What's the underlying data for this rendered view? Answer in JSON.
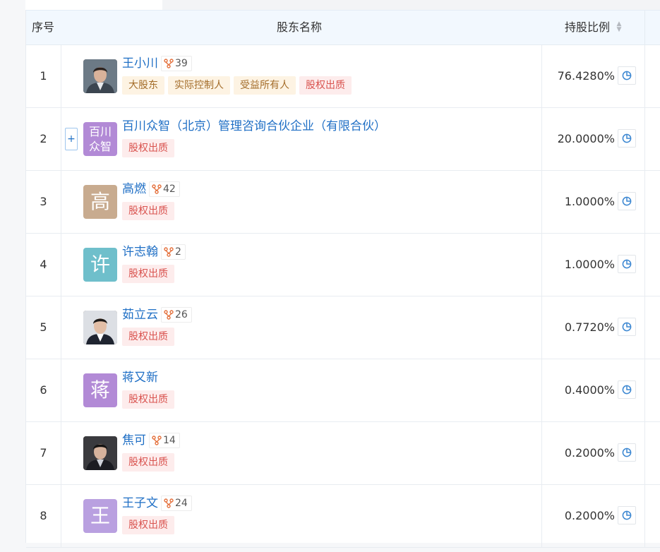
{
  "table": {
    "headers": {
      "index": "序号",
      "name": "股东名称",
      "ratio": "持股比例",
      "sort_icon": "sort-icon"
    },
    "colors": {
      "link": "#1f6fc5",
      "tag_gold_bg": "#fdf3e3",
      "tag_gold_fg": "#a46d2a",
      "tag_red_bg": "#fdecec",
      "tag_red_fg": "#d9534f"
    },
    "rows": [
      {
        "index": "1",
        "avatar_type": "photo",
        "name": "王小川",
        "relations": "39",
        "tags": [
          "大股东",
          "实际控制人",
          "受益所有人",
          "股权出质"
        ],
        "ratio": "76.4280%"
      },
      {
        "index": "2",
        "avatar_type": "text",
        "avatar_text": "百川众智",
        "avatar_color": "#b28ad6",
        "has_expand": true,
        "name": "百川众智（北京）管理咨询合伙企业（有限合伙）",
        "relations": "",
        "tags": [
          "股权出质"
        ],
        "ratio": "20.0000%"
      },
      {
        "index": "3",
        "avatar_type": "text",
        "avatar_text": "高",
        "avatar_color": "#c8ab8f",
        "name": "高燃",
        "relations": "42",
        "tags": [
          "股权出质"
        ],
        "ratio": "1.0000%"
      },
      {
        "index": "4",
        "avatar_type": "text",
        "avatar_text": "许",
        "avatar_color": "#6fbfcb",
        "name": "许志翰",
        "relations": "2",
        "tags": [
          "股权出质"
        ],
        "ratio": "1.0000%"
      },
      {
        "index": "5",
        "avatar_type": "photo",
        "name": "茹立云",
        "relations": "26",
        "tags": [
          "股权出质"
        ],
        "ratio": "0.7720%"
      },
      {
        "index": "6",
        "avatar_type": "text",
        "avatar_text": "蒋",
        "avatar_color": "#b28ad6",
        "name": "蒋又新",
        "relations": "",
        "tags": [
          "股权出质"
        ],
        "ratio": "0.4000%"
      },
      {
        "index": "7",
        "avatar_type": "photo",
        "name": "焦可",
        "relations": "14",
        "tags": [
          "股权出质"
        ],
        "ratio": "0.2000%"
      },
      {
        "index": "8",
        "avatar_type": "text",
        "avatar_text": "王",
        "avatar_color": "#b9a0e0",
        "name": "王子文",
        "relations": "24",
        "tags": [
          "股权出质"
        ],
        "ratio": "0.2000%"
      }
    ]
  }
}
